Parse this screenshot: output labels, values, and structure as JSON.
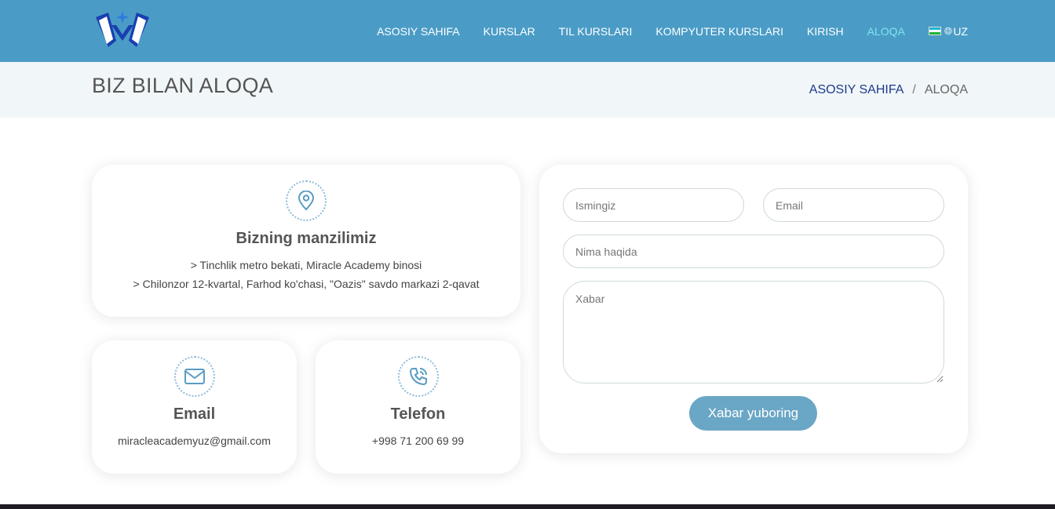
{
  "brand": {
    "logo_icon": "academy-logo-icon"
  },
  "nav": {
    "items": [
      {
        "label": "ASOSIY SAHIFA",
        "active": false
      },
      {
        "label": "KURSLAR",
        "active": false
      },
      {
        "label": "TIL KURSLARI",
        "active": false
      },
      {
        "label": "KOMPYUTER KURSLARI",
        "active": false
      },
      {
        "label": "KIRISH",
        "active": false
      },
      {
        "label": "ALOQA",
        "active": true
      }
    ],
    "language": {
      "flag": "uz-flag-icon",
      "globe": "globe-icon",
      "code": "UZ"
    }
  },
  "header": {
    "title": "BIZ BILAN ALOQA",
    "breadcrumb": {
      "home": "ASOSIY SAHIFA",
      "separator": "/",
      "current": "ALOQA"
    }
  },
  "contact": {
    "address": {
      "icon": "map-pin-icon",
      "title": "Bizning manzilimiz",
      "line1": "> Tinchlik metro bekati, Miracle Academy binosi",
      "line2": "> Chilonzor 12-kvartal, Farhod ko'chasi, \"Oazis\" savdo markazi 2-qavat"
    },
    "email": {
      "icon": "envelope-icon",
      "title": "Email",
      "value": "miracleacademyuz@gmail.com"
    },
    "phone": {
      "icon": "phone-icon",
      "title": "Telefon",
      "value": "+998 71 200 69 99"
    }
  },
  "form": {
    "name_placeholder": "Ismingiz",
    "email_placeholder": "Email",
    "subject_placeholder": "Nima haqida",
    "message_placeholder": "Xabar",
    "submit_label": "Xabar yuboring"
  },
  "colors": {
    "topbar": "#4a9cc6",
    "active_nav": "#7fe3ef",
    "button": "#6aa6c6",
    "breadcrumb_bg": "#f1f6f9"
  }
}
